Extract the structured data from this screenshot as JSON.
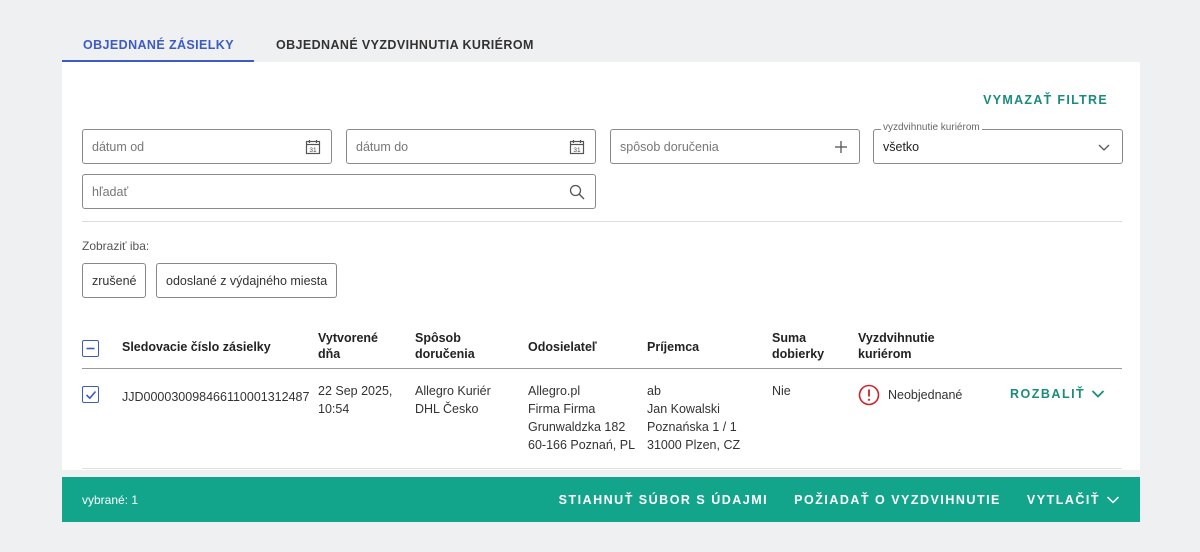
{
  "tabs": [
    {
      "label": "OBJEDNANÉ ZÁSIELKY"
    },
    {
      "label": "OBJEDNANÉ VYZDVIHNUTIA KURIÉROM"
    }
  ],
  "filters": {
    "clear_label": "VYMAZAŤ FILTRE",
    "date_from_placeholder": "dátum od",
    "date_to_placeholder": "dátum do",
    "calendar_day": "31",
    "delivery_placeholder": "spôsob doručenia",
    "pickup_legend": "vyzdvihnutie kuriérom",
    "pickup_value": "všetko",
    "search_placeholder": "hľadať",
    "show_only_label": "Zobraziť iba:",
    "chips": [
      "zrušené",
      "odoslané z výdajného miesta"
    ]
  },
  "table": {
    "headers": {
      "tracking": "Sledovacie číslo zásielky",
      "created_1": "Vytvorené",
      "created_2": "dňa",
      "delivery_1": "Spôsob",
      "delivery_2": "doručenia",
      "sender": "Odosielateľ",
      "recipient": "Príjemca",
      "cod_1": "Suma",
      "cod_2": "dobierky",
      "pickup_1": "Vyzdvihnutie",
      "pickup_2": "kuriérom"
    },
    "rows": [
      {
        "tracking": "JJD000030098466110001312487",
        "created_1": "22 Sep 2025,",
        "created_2": "10:54",
        "delivery_1": "Allegro Kuriér",
        "delivery_2": "DHL Česko",
        "sender_1": "Allegro.pl",
        "sender_2": "Firma Firma",
        "sender_3": "Grunwaldzka 182",
        "sender_4": "60-166 Poznań, PL",
        "recipient_1": "ab",
        "recipient_2": "Jan Kowalski",
        "recipient_3": "Poznańska 1 / 1",
        "recipient_4": "31000 Plzen, CZ",
        "cod": "Nie",
        "pickup_status": "Neobjednané",
        "expand_label": "ROZBALIŤ"
      }
    ]
  },
  "bottom_bar": {
    "selected": "vybrané: 1",
    "download": "STIAHNUŤ SÚBOR S ÚDAJMI",
    "request_pickup": "POŽIADAŤ O VYZDVIHNUTIE",
    "print": "VYTLAČIŤ"
  },
  "colors": {
    "accent_blue": "#3d5bc4",
    "teal": "#13a58c",
    "teal_text": "#1a8c7c",
    "warning_red": "#d0202a"
  }
}
